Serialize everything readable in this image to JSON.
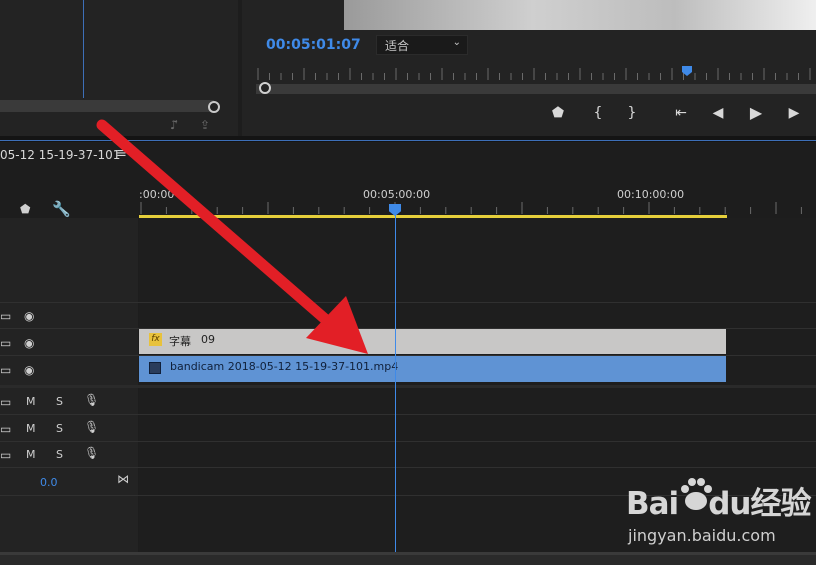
{
  "program_monitor": {
    "timecode": "00:05:01:07",
    "fit_select": {
      "value": "适合",
      "chevron": "⌄"
    },
    "transport_icons": [
      "marker-icon",
      "mark-in-icon",
      "mark-out-icon",
      "go-to-in-icon",
      "step-back-icon",
      "play-icon",
      "step-forward-icon"
    ],
    "transport_glyphs": [
      "⬟",
      "{",
      "}",
      "{←",
      "◀|",
      "▶",
      "|▶"
    ]
  },
  "sequence": {
    "name": "05-12 15-19-37-101",
    "menu_glyph": "≡"
  },
  "timeline": {
    "ruler_labels": [
      ":00:00",
      "00:05:00:00",
      "00:10:00:00"
    ],
    "playhead_fraction": 0.437
  },
  "tracks": {
    "video": [
      {
        "id": "v3"
      },
      {
        "id": "v2"
      },
      {
        "id": "v1"
      }
    ],
    "audio": [
      {
        "id": "a1",
        "mute": "M",
        "solo": "S"
      },
      {
        "id": "a2",
        "mute": "M",
        "solo": "S"
      },
      {
        "id": "a3",
        "mute": "M",
        "solo": "S"
      }
    ],
    "master_volume": "0.0"
  },
  "clips": {
    "title_clip": {
      "fx": "fx",
      "label": "字幕",
      "number": "09"
    },
    "video_clip": {
      "label": "bandicam 2018-05-12 15-19-37-101.mp4"
    }
  },
  "watermark": {
    "logo_text": "Bai",
    "logo_text2": "du",
    "logo_cn": "经验",
    "url": "jingyan.baidu.com"
  },
  "colors": {
    "accent": "#3f8ae8",
    "work_area": "#e6cf3b",
    "video_clip": "#5f93d4",
    "title_clip": "#c8c7c6",
    "arrow": "#e21f26"
  }
}
